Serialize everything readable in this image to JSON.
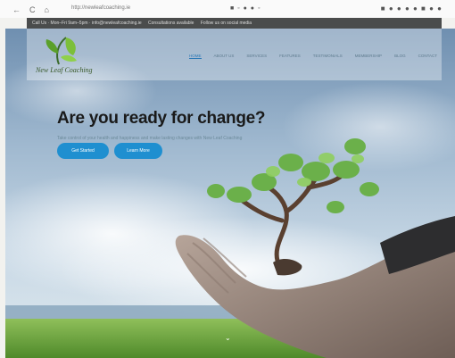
{
  "browser": {
    "back": "←",
    "refresh": "C",
    "home": "⌂",
    "address": "http://newleafcoaching.ie",
    "extensions": "■  ◦ ● ● ◦",
    "toolbar_right": "■ ● ● ● ● ■ ● ●"
  },
  "topbar": {
    "contact": "Call Us  ·  Mon–Fri 9am–5pm  ·  info@newleafcoaching.ie",
    "hours": "Consultations available",
    "follow": "Follow us on social media"
  },
  "site": {
    "logo_text": "New Leaf Coaching"
  },
  "menu": [
    {
      "label": "HOME",
      "active": true
    },
    {
      "label": "ABOUT US"
    },
    {
      "label": "SERVICES"
    },
    {
      "label": "FEATURES"
    },
    {
      "label": "TESTIMONIALS"
    },
    {
      "label": "MEMBERSHIP"
    },
    {
      "label": "BLOG"
    },
    {
      "label": "CONTACT"
    }
  ],
  "hero": {
    "title": "Are you ready for change?",
    "subtitle": "Take control of your health and happiness and make lasting changes with New Leaf Coaching",
    "button1": "Get Started",
    "button2": "Learn More",
    "scroll": "⌄"
  }
}
